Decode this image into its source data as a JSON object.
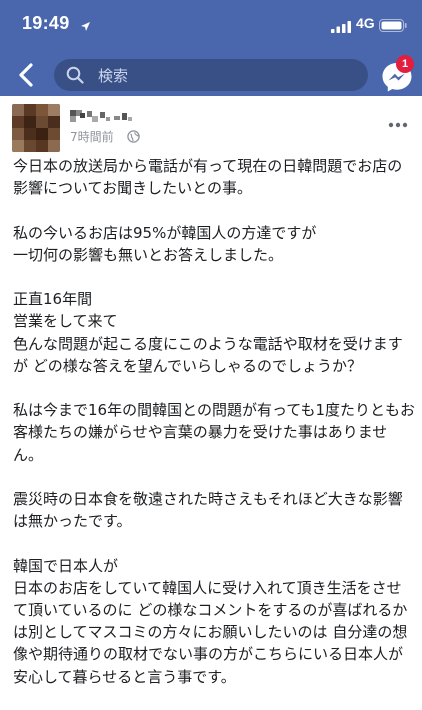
{
  "status_bar": {
    "time": "19:49",
    "network": "4G"
  },
  "header": {
    "search_placeholder": "検索",
    "notification_count": "1",
    "accent_color": "#4a67ad",
    "icons": [
      "back-arrow-icon",
      "search-icon",
      "messenger-icon"
    ]
  },
  "post": {
    "author_name_pixelated": true,
    "timestamp": "7時間前",
    "privacy_icon": "globe-icon",
    "paragraphs": [
      "今日本の放送局から電話が有って現在の日韓問題でお店の\n影響についてお聞きしたいとの事。",
      "私の今いるお店は95%が韓国人の方達ですが\n一切何の影響も無いとお答えしました。",
      "正直16年間\n営業をして来て\n色んな問題が起こる度にこのような電話や取材を受けます\nが どの様な答えを望んでいらしゃるのでしょうか？",
      "私は今まで16年の間韓国との問題が有っても1度たりともお\n客様たちの嫌がらせや言葉の暴力を受けた事はありませ\nん。",
      "震災時の日本食を敬遠された時さえもそれほど大きな影響\nは無かったです。",
      "韓国で日本人が\n日本のお店をしていて韓国人に受け入れて頂き生活をさせ\nて頂いているのに どの様なコメントをするのが喜ばれるか\nは別としてマスコミの方々にお願いしたいのは 自分達の想\n像や期待通りの取材でない事の方がこちらにいる日本人が\n安心して暮らせると言う事です。"
    ]
  }
}
